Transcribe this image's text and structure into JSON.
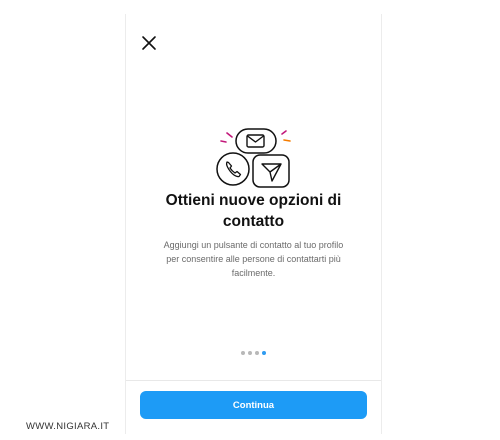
{
  "screen": {
    "close_icon": "close-icon",
    "hero_icons": [
      "message-bubble-icon",
      "phone-icon",
      "direct-send-icon"
    ],
    "title_lines": [
      "Ottieni nuove opzioni di",
      "contatto"
    ],
    "description_lines": [
      "Aggiungi un pulsante di contatto al tuo profilo",
      "per consentire alle persone di contattarti più",
      "facilmente."
    ],
    "pager": {
      "total": 4,
      "current": 4
    },
    "continue_label": "Continua"
  },
  "watermark": {
    "text": "WWW.NIGIARA.IT"
  },
  "colors": {
    "accent": "#1d9bf6",
    "active_dot": "#2f9bf0",
    "sparkle_magenta": "#c2187a",
    "sparkle_orange": "#f57c00"
  }
}
